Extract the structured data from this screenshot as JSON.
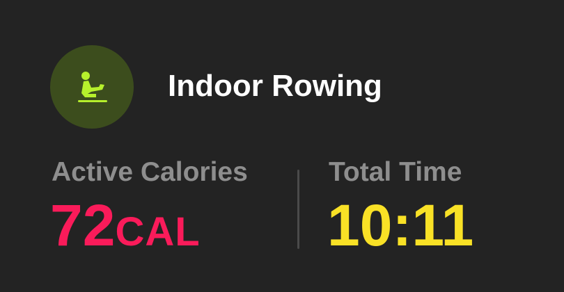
{
  "workout": {
    "title": "Indoor Rowing",
    "icon": "rowing-icon",
    "icon_color": "#b6f02c",
    "icon_bg": "#3c4d1d"
  },
  "metrics": {
    "calories": {
      "label": "Active Calories",
      "value": "72",
      "unit": "CAL",
      "color": "#fa1b5a"
    },
    "time": {
      "label": "Total Time",
      "value": "10:11",
      "color": "#f9e126"
    }
  }
}
